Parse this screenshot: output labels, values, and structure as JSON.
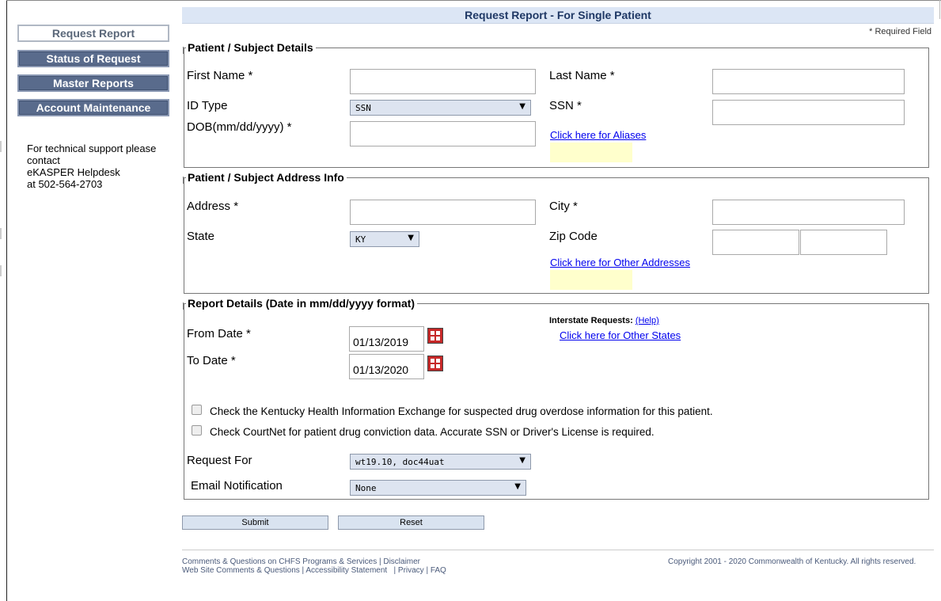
{
  "header": {
    "title": "Request Report - For Single Patient",
    "required_note": "* Required Field"
  },
  "sidebar": {
    "items": [
      {
        "label": "Request Report"
      },
      {
        "label": "Status of Request"
      },
      {
        "label": "Master Reports"
      },
      {
        "label": "Account Maintenance"
      }
    ],
    "support": {
      "line1": "For technical support please contact",
      "line2": "eKASPER Helpdesk",
      "line3": "at 502-564-2703"
    }
  },
  "patient": {
    "legend": "Patient / Subject Details",
    "first_name_label": "First Name *",
    "first_name_value": "",
    "last_name_label": "Last Name *",
    "last_name_value": "",
    "id_type_label": "ID Type",
    "id_type_value": "SSN",
    "ssn_label": "SSN *",
    "ssn_value": "",
    "dob_label": "DOB(mm/dd/yyyy) *",
    "dob_value": "",
    "aliases_link": "Click here for Aliases"
  },
  "address": {
    "legend": "Patient / Subject Address Info",
    "address_label": "Address *",
    "address_value": "",
    "city_label": "City *",
    "city_value": "",
    "state_label": "State",
    "state_value": "KY",
    "zip_label": "Zip Code",
    "zip_value": "",
    "zip_ext_value": "",
    "other_addresses_link": "Click here for Other Addresses"
  },
  "report": {
    "legend": "Report Details (Date in mm/dd/yyyy format)",
    "from_label": "From Date *",
    "from_value": "01/13/2019",
    "to_label": "To Date *",
    "to_value": "01/13/2020",
    "interstate_label": "Interstate Requests:",
    "help_link": "(Help)",
    "other_states_link": "Click here for Other States",
    "check1": "Check the Kentucky Health Information Exchange for suspected drug overdose information for this patient.",
    "check2": "Check CourtNet for patient drug conviction data. Accurate SSN or Driver's License is required.",
    "request_for_label": "Request For",
    "request_for_value": "wt19.10, doc44uat",
    "email_label": "Email Notification",
    "email_value": "None"
  },
  "buttons": {
    "submit": "Submit",
    "reset": "Reset"
  },
  "footer": {
    "line1": "Comments & Questions on CHFS Programs & Services | Disclaimer",
    "line2": "Web Site Comments & Questions | Accessibility Statement   | Privacy | FAQ",
    "copyright": "Copyright 2001 - 2020 Commonwealth of Kentucky. All rights reserved."
  },
  "icons": {
    "calendar": "calendar-icon",
    "dropdown": "dropdown-arrow-icon"
  }
}
